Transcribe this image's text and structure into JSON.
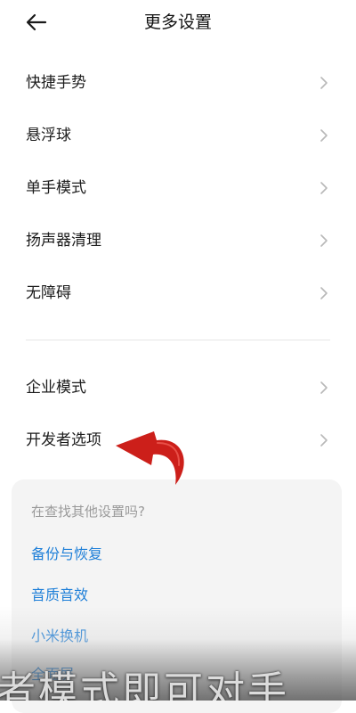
{
  "header": {
    "title": "更多设置",
    "back_icon": "back-arrow-icon"
  },
  "menu": {
    "items": [
      {
        "label": "快捷手势"
      },
      {
        "label": "悬浮球"
      },
      {
        "label": "单手模式"
      },
      {
        "label": "扬声器清理"
      },
      {
        "label": "无障碍"
      },
      {
        "label": "企业模式"
      },
      {
        "label": "开发者选项"
      }
    ]
  },
  "suggestions": {
    "hint": "在查找其他设置吗?",
    "links": [
      "备份与恢复",
      "音质音效",
      "小米换机",
      "全面屏"
    ]
  },
  "overlay": {
    "caption": "者模式即可对手",
    "annotation_arrow_color": "#cc1f1a"
  },
  "colors": {
    "link": "#1e7fd8",
    "hint": "#9a9a9a",
    "card_bg": "#f4f4f4"
  }
}
